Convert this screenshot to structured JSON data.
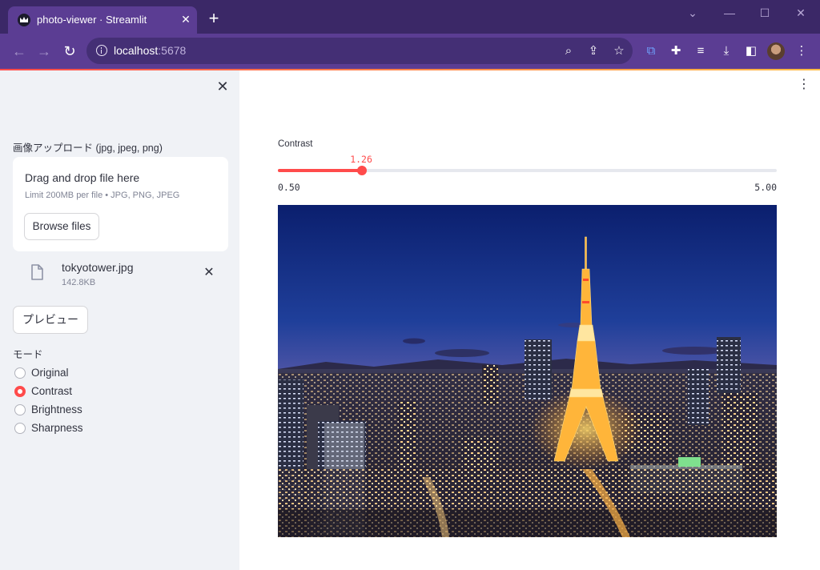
{
  "browser": {
    "tab_title": "photo-viewer · Streamlit",
    "url_host": "localhost",
    "url_port": ":5678"
  },
  "sidebar": {
    "uploader_label": "画像アップロード (jpg, jpeg, png)",
    "dropzone_title": "Drag and drop file here",
    "dropzone_limit": "Limit 200MB per file • JPG, PNG, JPEG",
    "browse_label": "Browse files",
    "file": {
      "name": "tokyotower.jpg",
      "size": "142.8KB"
    },
    "preview_label": "プレビュー",
    "mode_label": "モード",
    "modes": [
      {
        "label": "Original",
        "selected": false
      },
      {
        "label": "Contrast",
        "selected": true
      },
      {
        "label": "Brightness",
        "selected": false
      },
      {
        "label": "Sharpness",
        "selected": false
      }
    ]
  },
  "main": {
    "slider": {
      "label": "Contrast",
      "value": 1.26,
      "value_text": "1.26",
      "min": 0.5,
      "max": 5.0,
      "min_text": "0.50",
      "max_text": "5.00"
    }
  },
  "colors": {
    "accent": "#ff4b4b",
    "sidebar_bg": "#f0f2f6",
    "browser_frame": "#3b2867"
  },
  "icons": {
    "favicon": "streamlit-crown-icon",
    "file": "file-icon",
    "close": "close-icon",
    "menu": "kebab-menu-icon"
  }
}
